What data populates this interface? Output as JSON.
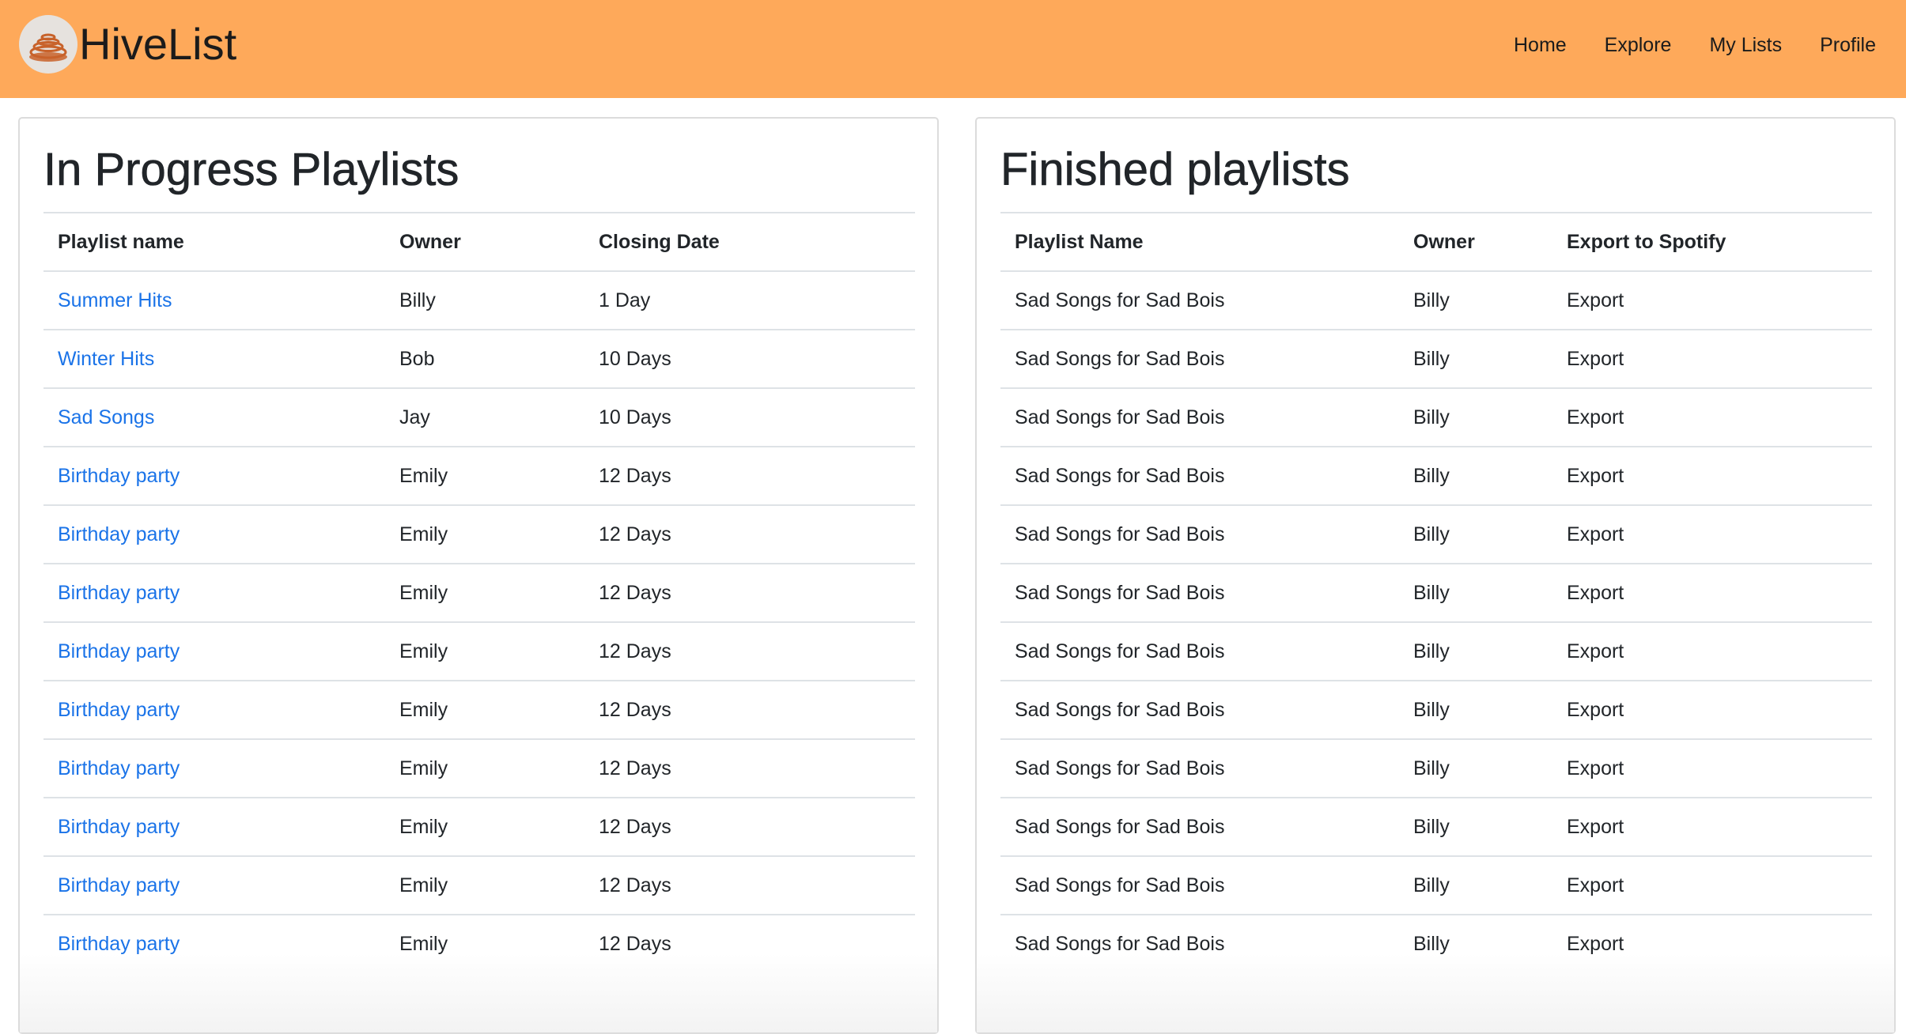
{
  "brand": {
    "name": "HiveList",
    "logo_icon": "hive-logo-icon"
  },
  "nav": {
    "items": [
      "Home",
      "Explore",
      "My Lists",
      "Profile"
    ]
  },
  "colors": {
    "navbar": "#fea95a",
    "link": "#1a73e8"
  },
  "in_progress": {
    "title": "In Progress Playlists",
    "columns": [
      "Playlist name",
      "Owner",
      "Closing Date"
    ],
    "rows": [
      [
        "Summer Hits",
        "Billy",
        "1 Day"
      ],
      [
        "Winter Hits",
        "Bob",
        "10 Days"
      ],
      [
        "Sad Songs",
        "Jay",
        "10 Days"
      ],
      [
        "Birthday party",
        "Emily",
        "12 Days"
      ],
      [
        "Birthday party",
        "Emily",
        "12 Days"
      ],
      [
        "Birthday party",
        "Emily",
        "12 Days"
      ],
      [
        "Birthday party",
        "Emily",
        "12 Days"
      ],
      [
        "Birthday party",
        "Emily",
        "12 Days"
      ],
      [
        "Birthday party",
        "Emily",
        "12 Days"
      ],
      [
        "Birthday party",
        "Emily",
        "12 Days"
      ],
      [
        "Birthday party",
        "Emily",
        "12 Days"
      ],
      [
        "Birthday party",
        "Emily",
        "12 Days"
      ]
    ]
  },
  "finished": {
    "title": "Finished playlists",
    "columns": [
      "Playlist Name",
      "Owner",
      "Export to Spotify"
    ],
    "rows": [
      [
        "Sad Songs for Sad Bois",
        "Billy",
        "Export"
      ],
      [
        "Sad Songs for Sad Bois",
        "Billy",
        "Export"
      ],
      [
        "Sad Songs for Sad Bois",
        "Billy",
        "Export"
      ],
      [
        "Sad Songs for Sad Bois",
        "Billy",
        "Export"
      ],
      [
        "Sad Songs for Sad Bois",
        "Billy",
        "Export"
      ],
      [
        "Sad Songs for Sad Bois",
        "Billy",
        "Export"
      ],
      [
        "Sad Songs for Sad Bois",
        "Billy",
        "Export"
      ],
      [
        "Sad Songs for Sad Bois",
        "Billy",
        "Export"
      ],
      [
        "Sad Songs for Sad Bois",
        "Billy",
        "Export"
      ],
      [
        "Sad Songs for Sad Bois",
        "Billy",
        "Export"
      ],
      [
        "Sad Songs for Sad Bois",
        "Billy",
        "Export"
      ],
      [
        "Sad Songs for Sad Bois",
        "Billy",
        "Export"
      ]
    ]
  }
}
